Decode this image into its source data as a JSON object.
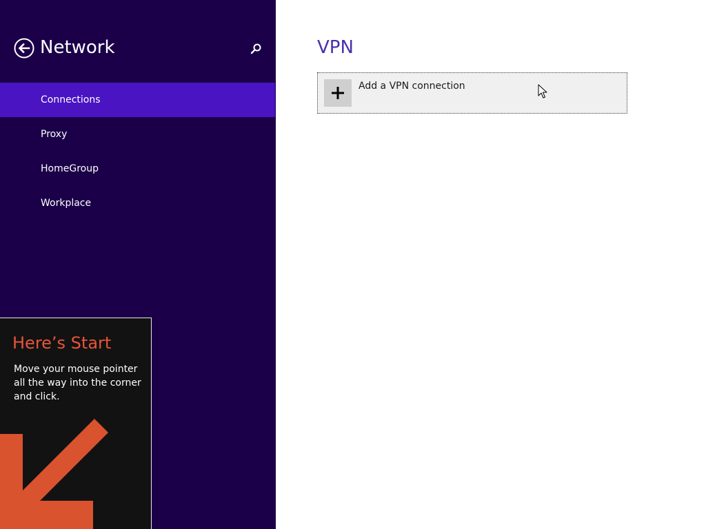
{
  "left_pane": {
    "header_title": "Network",
    "back_icon": "back-arrow-icon",
    "search_icon": "search-icon",
    "nav_items": [
      {
        "label": "Connections",
        "selected": true
      },
      {
        "label": "Proxy",
        "selected": false
      },
      {
        "label": "HomeGroup",
        "selected": false
      },
      {
        "label": "Workplace",
        "selected": false
      }
    ]
  },
  "start_tip": {
    "title": "Here’s Start",
    "body": "Move your mouse pointer all the way into the corner and click.",
    "arrow_icon": "corner-arrow-icon"
  },
  "main": {
    "section_title": "VPN",
    "add_vpn_label": "Add a VPN connection",
    "add_icon": "plus-icon"
  },
  "colors": {
    "pane_bg": "#1b0049",
    "selected_bg": "#4a14c2",
    "accent_title": "#4a2fae",
    "tip_title": "#e8553a",
    "tip_arrow": "#d9532e"
  }
}
